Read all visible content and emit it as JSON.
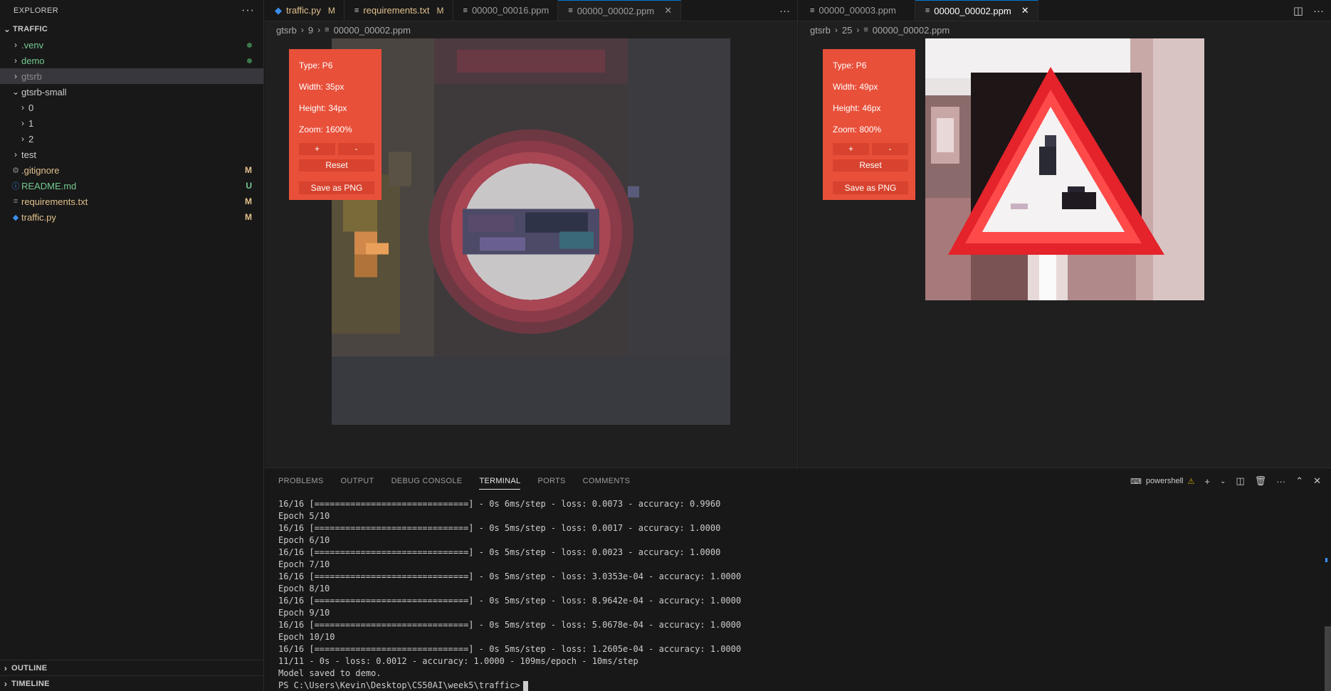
{
  "sidebar": {
    "title": "EXPLORER",
    "more": "···",
    "root": "TRAFFIC",
    "items": [
      {
        "label": ".venv",
        "badge": ""
      },
      {
        "label": "demo",
        "badge": ""
      },
      {
        "label": "gtsrb",
        "badge": ""
      },
      {
        "label": "gtsrb-small",
        "badge": ""
      },
      {
        "label": "0",
        "badge": ""
      },
      {
        "label": "1",
        "badge": ""
      },
      {
        "label": "2",
        "badge": ""
      },
      {
        "label": "test",
        "badge": ""
      },
      {
        "label": ".gitignore",
        "badge": "M"
      },
      {
        "label": "README.md",
        "badge": "U"
      },
      {
        "label": "requirements.txt",
        "badge": "M"
      },
      {
        "label": "traffic.py",
        "badge": "M"
      }
    ],
    "outline": "OUTLINE",
    "timeline": "TIMELINE"
  },
  "editor_left": {
    "tabs": [
      {
        "label": "traffic.py",
        "badge": "M"
      },
      {
        "label": "requirements.txt",
        "badge": "M"
      },
      {
        "label": "00000_00016.ppm",
        "badge": ""
      },
      {
        "label": "00000_00002.ppm",
        "badge": ""
      }
    ],
    "more": "···",
    "breadcrumb": [
      "gtsrb",
      "9",
      "00000_00002.ppm"
    ],
    "info": {
      "type": "Type: P6",
      "width": "Width: 35px",
      "height": "Height: 34px",
      "zoom": "Zoom: 1600%",
      "plus": "+",
      "minus": "-",
      "reset": "Reset",
      "save": "Save as PNG"
    }
  },
  "editor_right": {
    "tabs": [
      {
        "label": "00000_00003.ppm",
        "badge": ""
      },
      {
        "label": "00000_00002.ppm",
        "badge": ""
      }
    ],
    "more": "···",
    "breadcrumb": [
      "gtsrb",
      "25",
      "00000_00002.ppm"
    ],
    "info": {
      "type": "Type: P6",
      "width": "Width: 49px",
      "height": "Height: 46px",
      "zoom": "Zoom: 800%",
      "plus": "+",
      "minus": "-",
      "reset": "Reset",
      "save": "Save as PNG"
    }
  },
  "panel": {
    "tabs": [
      "PROBLEMS",
      "OUTPUT",
      "DEBUG CONSOLE",
      "TERMINAL",
      "PORTS",
      "COMMENTS"
    ],
    "active_tab": "TERMINAL",
    "shell": "powershell",
    "lines": [
      "16/16 [==============================] - 0s 6ms/step - loss: 0.0073 - accuracy: 0.9960",
      "Epoch 5/10",
      "16/16 [==============================] - 0s 5ms/step - loss: 0.0017 - accuracy: 1.0000",
      "Epoch 6/10",
      "16/16 [==============================] - 0s 5ms/step - loss: 0.0023 - accuracy: 1.0000",
      "Epoch 7/10",
      "16/16 [==============================] - 0s 5ms/step - loss: 3.0353e-04 - accuracy: 1.0000",
      "Epoch 8/10",
      "16/16 [==============================] - 0s 5ms/step - loss: 8.9642e-04 - accuracy: 1.0000",
      "Epoch 9/10",
      "16/16 [==============================] - 0s 5ms/step - loss: 5.0678e-04 - accuracy: 1.0000",
      "Epoch 10/10",
      "16/16 [==============================] - 0s 5ms/step - loss: 1.2605e-04 - accuracy: 1.0000",
      "11/11 - 0s - loss: 0.0012 - accuracy: 1.0000 - 109ms/epoch - 10ms/step",
      "Model saved to demo."
    ],
    "prompt": "PS C:\\Users\\Kevin\\Desktop\\CS50AI\\week5\\traffic>"
  }
}
